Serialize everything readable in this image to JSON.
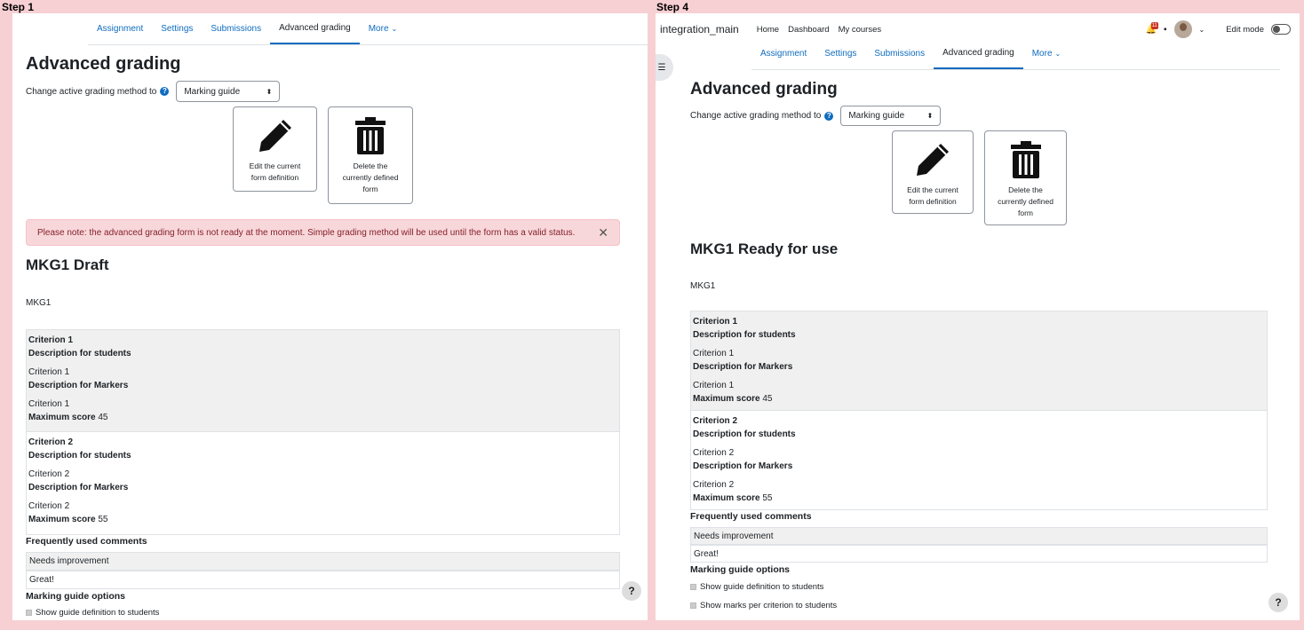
{
  "step1": {
    "label": "Step 1",
    "tabs": [
      "Assignment",
      "Settings",
      "Submissions",
      "Advanced grading",
      "More"
    ],
    "heading": "Advanced grading",
    "change_label": "Change active grading method to",
    "method": "Marking guide",
    "edit_btn": [
      "Edit the current",
      "form definition"
    ],
    "delete_btn": [
      "Delete the",
      "currently defined",
      "form"
    ],
    "alert": "Please note: the advanced grading form is not ready at the moment. Simple grading method will be used until the form has a valid status.",
    "title": "MKG1 Draft",
    "description": "MKG1",
    "criteria": [
      {
        "name": "Criterion 1",
        "desc_students_label": "Description for students",
        "desc_students": "Criterion 1",
        "desc_markers_label": "Description for Markers",
        "desc_markers": "Criterion 1",
        "max_label": "Maximum score",
        "max": "45"
      },
      {
        "name": "Criterion 2",
        "desc_students_label": "Description for students",
        "desc_students": "Criterion 2",
        "desc_markers_label": "Description for Markers",
        "desc_markers": "Criterion 2",
        "max_label": "Maximum score",
        "max": "55"
      }
    ],
    "comments_heading": "Frequently used comments",
    "comments": [
      "Needs improvement",
      "Great!"
    ],
    "options_heading": "Marking guide options",
    "options": [
      "Show guide definition to students"
    ]
  },
  "step4": {
    "label": "Step 4",
    "site": "integration_main",
    "nav": [
      "Home",
      "Dashboard",
      "My courses"
    ],
    "notif_count": "11",
    "edit_mode": "Edit mode",
    "tabs": [
      "Assignment",
      "Settings",
      "Submissions",
      "Advanced grading",
      "More"
    ],
    "heading": "Advanced grading",
    "change_label": "Change active grading method to",
    "method": "Marking guide",
    "edit_btn": [
      "Edit the current",
      "form definition"
    ],
    "delete_btn": [
      "Delete the",
      "currently defined",
      "form"
    ],
    "title": "MKG1 Ready for use",
    "description": "MKG1",
    "criteria": [
      {
        "name": "Criterion 1",
        "desc_students_label": "Description for students",
        "desc_students": "Criterion 1",
        "desc_markers_label": "Description for Markers",
        "desc_markers": "Criterion 1",
        "max_label": "Maximum score",
        "max": "45"
      },
      {
        "name": "Criterion 2",
        "desc_students_label": "Description for students",
        "desc_students": "Criterion 2",
        "desc_markers_label": "Description for Markers",
        "desc_markers": "Criterion 2",
        "max_label": "Maximum score",
        "max": "55"
      }
    ],
    "comments_heading": "Frequently used comments",
    "comments": [
      "Needs improvement",
      "Great!"
    ],
    "options_heading": "Marking guide options",
    "options": [
      "Show guide definition to students",
      "Show marks per criterion to students"
    ]
  },
  "help": "?"
}
